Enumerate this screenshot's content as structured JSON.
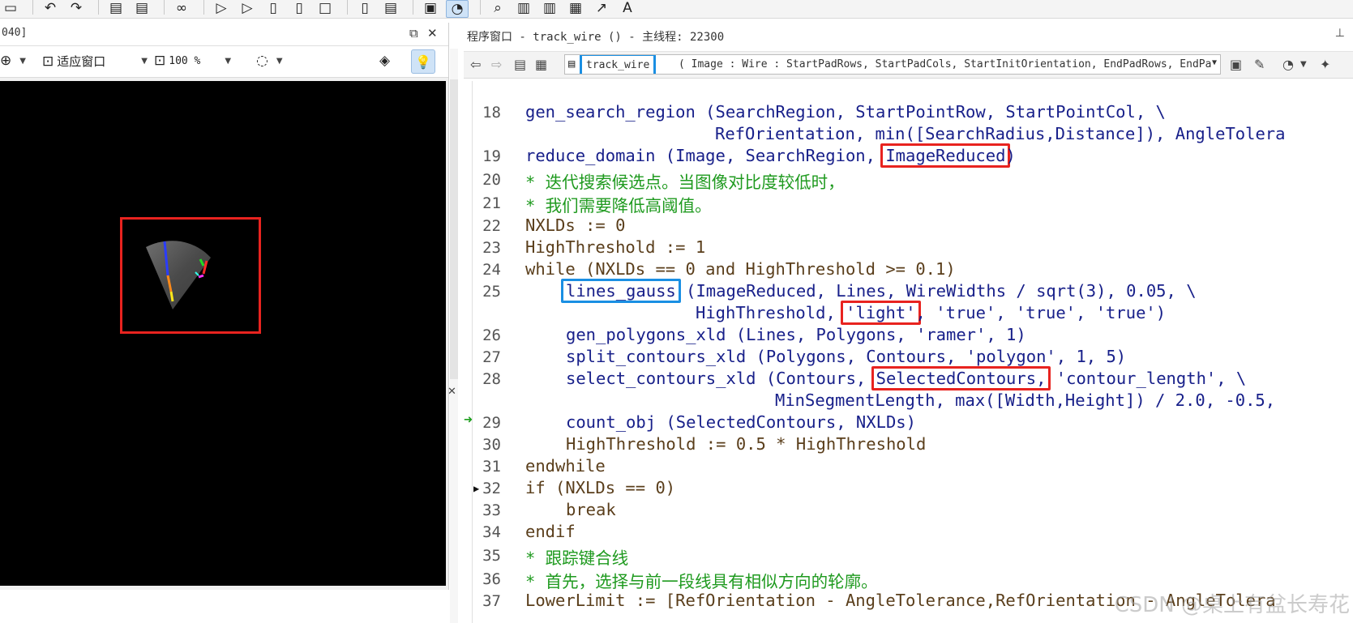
{
  "graphics_window": {
    "title": "040]",
    "restore_btn": "⧉",
    "close_btn": "✕",
    "fit_window_label": "适应窗口",
    "zoom_value": "100 %"
  },
  "program_window": {
    "title": "程序窗口 - track_wire () - 主线程: 22300",
    "procedure_name": "track_wire",
    "procedure_signature": "( Image : Wire : StartPadRows, StartPadCols, StartInitOrientation, EndPadRows, EndPa"
  },
  "code_lines": [
    {
      "n": "18",
      "text": "gen_search_region (SearchRegion, StartPointRow, StartPointCol, \\"
    },
    {
      "n": "",
      "text": "RefOrientation, min([SearchRadius,Distance]), AngleTolera"
    },
    {
      "n": "19",
      "pre": "reduce_domain (Image, SearchRegion, ",
      "hl": "ImageReduced",
      "post": ")"
    },
    {
      "n": "20",
      "text": "* 迭代搜索候选点。当图像对比度较低时，"
    },
    {
      "n": "21",
      "text": "* 我们需要降低高阈值。"
    },
    {
      "n": "22",
      "text": "NXLDs := 0"
    },
    {
      "n": "23",
      "text": "HighThreshold := 1"
    },
    {
      "n": "24",
      "text": "while (NXLDs == 0 and HighThreshold >= 0.1)"
    },
    {
      "n": "25",
      "hl": "lines_gauss",
      "post": " (ImageReduced, Lines, WireWidths / sqrt(3), 0.05, \\"
    },
    {
      "n": "",
      "pre": "HighThreshold, ",
      "hl": "'light'",
      "post": ", 'true', 'true', 'true')"
    },
    {
      "n": "26",
      "text": "gen_polygons_xld (Lines, Polygons, 'ramer', 1)"
    },
    {
      "n": "27",
      "text": "split_contours_xld (Polygons, Contours, 'polygon', 1, 5)"
    },
    {
      "n": "28",
      "pre": "select_contours_xld (Contours, ",
      "hl": "SelectedContours,",
      "post": " 'contour_length', \\"
    },
    {
      "n": "",
      "text": "MinSegmentLength, max([Width,Height]) / 2.0, -0.5,"
    },
    {
      "n": "29",
      "text": "count_obj (SelectedContours, NXLDs)"
    },
    {
      "n": "30",
      "text": "HighThreshold := 0.5 * HighThreshold"
    },
    {
      "n": "31",
      "text": "endwhile"
    },
    {
      "n": "32",
      "text": "if (NXLDs == 0)"
    },
    {
      "n": "33",
      "text": "break"
    },
    {
      "n": "34",
      "text": "endif"
    },
    {
      "n": "35",
      "text": "* 跟踪键合线"
    },
    {
      "n": "36",
      "text": "* 首先，选择与前一段线具有相似方向的轮廓。"
    },
    {
      "n": "37",
      "text": "LowerLimit := [RefOrientation - AngleTolerance,RefOrientation - AngleTolera"
    }
  ],
  "watermark": "CSDN @桌上有盆长寿花",
  "colors": {
    "highlight_red": "#e8231f",
    "highlight_blue": "#1a8fe3",
    "operator_blue": "#18208a",
    "comment_green": "#1f9a1f",
    "control_brown": "#5a3e1b"
  }
}
